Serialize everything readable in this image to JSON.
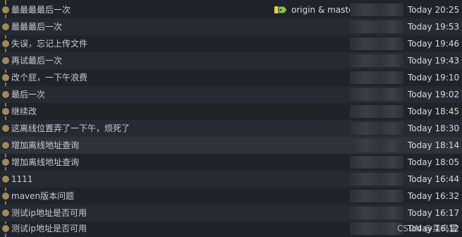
{
  "branch_tag": {
    "label": "origin & master",
    "icon": "branch-tag-icon"
  },
  "commits": [
    {
      "message": "最最最最后一次",
      "date": "Today 20:25"
    },
    {
      "message": "最最最后一次",
      "date": "Today 19:53"
    },
    {
      "message": "失误，忘记上传文件",
      "date": "Today 19:46"
    },
    {
      "message": "再试最后一次",
      "date": "Today 19:43"
    },
    {
      "message": "改个屁，一下午浪费",
      "date": "Today 19:10"
    },
    {
      "message": "最后一次",
      "date": "Today 19:02"
    },
    {
      "message": "继续改",
      "date": "Today 18:45"
    },
    {
      "message": "这离线位置弄了一下午，烦死了",
      "date": "Today 18:30"
    },
    {
      "message": "增加离线地址查询",
      "date": "Today 18:14"
    },
    {
      "message": "增加离线地址查询",
      "date": "Today 18:05"
    },
    {
      "message": "1111",
      "date": "Today 16:44"
    },
    {
      "message": "maven版本问题",
      "date": "Today 16:32"
    },
    {
      "message": "测试ip地址是否可用",
      "date": "Today 16:17"
    },
    {
      "message": "测试ip地址是否可用",
      "date": "Today 16:12"
    }
  ],
  "watermark": "CSDN @菜鸟雷",
  "colors": {
    "graph": "#9e895b",
    "background": "#1f232a",
    "tag_green": "#8bc34a",
    "tag_yellow": "#f2c94c"
  }
}
